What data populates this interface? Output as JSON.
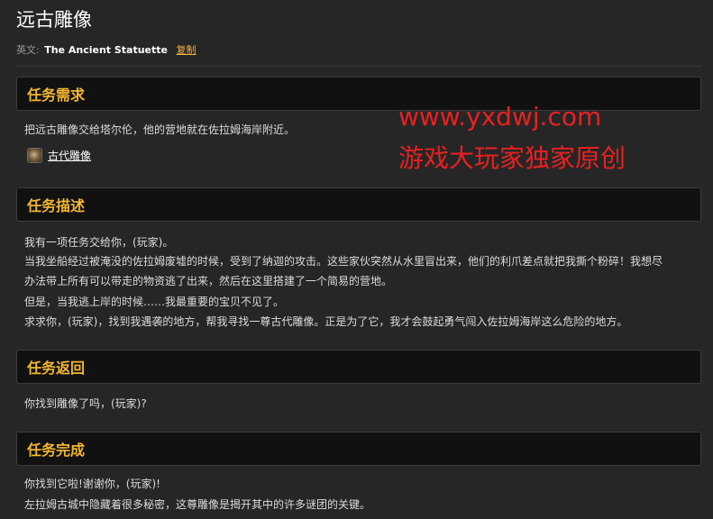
{
  "page": {
    "title": "远古雕像",
    "en_label": "英文:",
    "en_name": "The Ancient Statuette",
    "copy_link": "复制"
  },
  "sections": {
    "objective": {
      "header": "任务需求",
      "text": "把远古雕像交给塔尔伦，他的营地就在佐拉姆海岸附近。",
      "item_label": "古代雕像",
      "item_icon": "statuette-icon"
    },
    "description": {
      "header": "任务描述",
      "lines": [
        "我有一项任务交给你，(玩家)。",
        "当我坐船经过被淹没的佐拉姆废墟的时候，受到了纳迦的攻击。这些家伙突然从水里冒出来，他们的利爪差点就把我撕个粉碎！我想尽",
        "办法带上所有可以带走的物资逃了出来，然后在这里搭建了一个简易的营地。",
        "但是，当我逃上岸的时候……我最重要的宝贝不见了。",
        "求求你，(玩家)，找到我遇袭的地方，帮我寻找一尊古代雕像。正是为了它，我才会鼓起勇气闯入佐拉姆海岸这么危险的地方。"
      ]
    },
    "progress": {
      "header": "任务返回",
      "text": "你找到雕像了吗，(玩家)?"
    },
    "completion": {
      "header": "任务完成",
      "lines": [
        "你找到它啦!谢谢你，(玩家)!",
        "左拉姆古城中隐藏着很多秘密，这尊雕像是揭开其中的许多谜团的关键。"
      ]
    }
  },
  "watermark": {
    "url": "www.yxdwj.com",
    "slogan": "游戏大玩家独家原创"
  },
  "colors": {
    "background": "#262626",
    "header_bg": "#111111",
    "accent": "#f2b630",
    "link": "#f0b43c",
    "watermark": "#e82020"
  }
}
